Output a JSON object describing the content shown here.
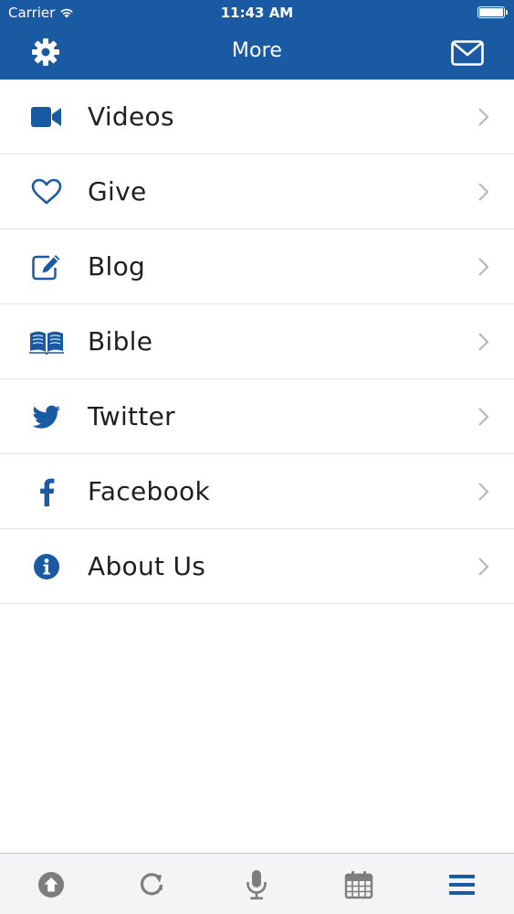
{
  "status_bar": {
    "carrier": "Carrier",
    "time": "11:43 AM"
  },
  "header": {
    "title": "More",
    "background_color": "#1a5aa3",
    "left_icon": "gear-icon",
    "right_icon": "envelope-icon"
  },
  "menu": {
    "items": [
      {
        "label": "Videos",
        "icon": "video-camera-icon"
      },
      {
        "label": "Give",
        "icon": "heart-icon"
      },
      {
        "label": "Blog",
        "icon": "edit-icon"
      },
      {
        "label": "Bible",
        "icon": "book-icon"
      },
      {
        "label": "Twitter",
        "icon": "twitter-icon"
      },
      {
        "label": "Facebook",
        "icon": "facebook-icon"
      },
      {
        "label": "About Us",
        "icon": "info-icon"
      }
    ]
  },
  "tab_bar": {
    "tabs": [
      {
        "icon": "upload-arrow-icon",
        "active": false
      },
      {
        "icon": "refresh-icon",
        "active": false
      },
      {
        "icon": "microphone-icon",
        "active": false
      },
      {
        "icon": "calendar-icon",
        "active": false
      },
      {
        "icon": "hamburger-menu-icon",
        "active": true
      }
    ],
    "active_color": "#1a5aa3",
    "inactive_color": "#7d7d80"
  },
  "colors": {
    "accent": "#1a5aa3",
    "text": "#1f1f1f",
    "divider": "#e3e3e6"
  }
}
